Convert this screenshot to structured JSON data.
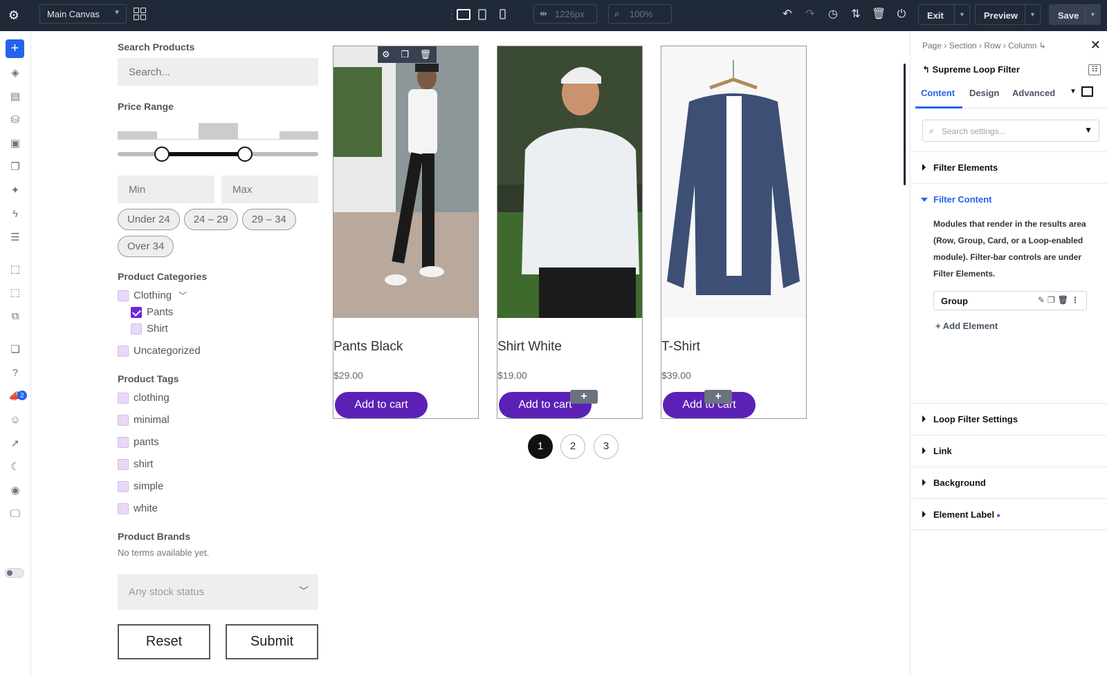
{
  "topbar": {
    "canvas_label": "Main Canvas",
    "width_value": "1226px",
    "zoom_value": "100%",
    "exit_label": "Exit",
    "preview_label": "Preview",
    "save_label": "Save"
  },
  "filters": {
    "search_label": "Search Products",
    "search_placeholder": "Search...",
    "price_label": "Price Range",
    "min_placeholder": "Min",
    "max_placeholder": "Max",
    "price_chips": [
      "Under 24",
      "24 – 29",
      "29 – 34",
      "Over 34"
    ],
    "categories_label": "Product Categories",
    "categories": [
      {
        "label": "Clothing",
        "checked": false
      },
      {
        "label": "Pants",
        "checked": true
      },
      {
        "label": "Shirt",
        "checked": false
      },
      {
        "label": "Uncategorized",
        "checked": false
      }
    ],
    "tags_label": "Product Tags",
    "tags": [
      "clothing",
      "minimal",
      "pants",
      "shirt",
      "simple",
      "white"
    ],
    "brands_label": "Product Brands",
    "brands_empty": "No terms available yet.",
    "stock_placeholder": "Any stock status",
    "reset_label": "Reset",
    "submit_label": "Submit"
  },
  "products": [
    {
      "title": "Pants Black",
      "price": "$29.00",
      "button": "Add to cart"
    },
    {
      "title": "Shirt White",
      "price": "$19.00",
      "button": "Add to cart"
    },
    {
      "title": "T-Shirt",
      "price": "$39.00",
      "button": "Add to cart"
    }
  ],
  "pagination": [
    "1",
    "2",
    "3"
  ],
  "panel": {
    "breadcrumb": [
      "Page",
      "Section",
      "Row",
      "Column"
    ],
    "title": "Supreme Loop Filter",
    "tabs": [
      "Content",
      "Design",
      "Advanced"
    ],
    "search_placeholder": "Search settings...",
    "sections": {
      "filter_elements": "Filter Elements",
      "filter_content": "Filter Content",
      "loop_filter_settings": "Loop Filter Settings",
      "link": "Link",
      "background": "Background",
      "element_label": "Element Label"
    },
    "description": "Modules that render in the results area (Row, Group, Card, or a Loop-enabled module). Filter-bar controls are under Filter Elements.",
    "group_label": "Group",
    "add_element_label": "Add Element"
  },
  "leftbar": {
    "notification_count": "2"
  },
  "colors": {
    "topbar": "#1f2937",
    "accent": "#2563eb",
    "button_purple": "#5b21b6",
    "checkbox": "#ead8f7"
  }
}
